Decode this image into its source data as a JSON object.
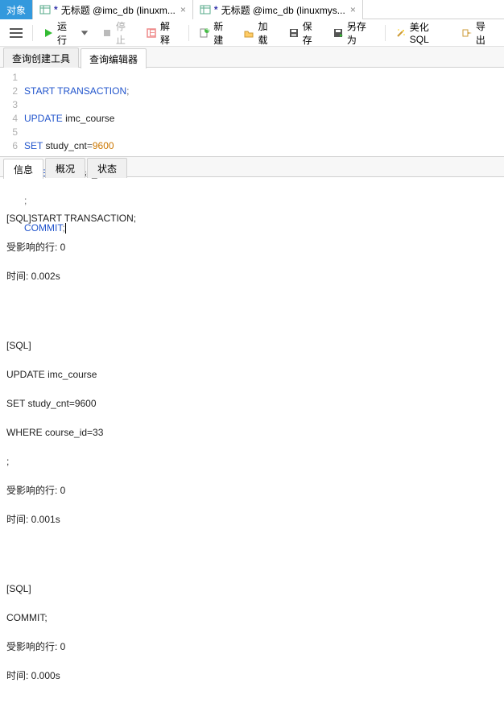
{
  "top_tabs": {
    "t0": "对象",
    "t1_dirty": "*",
    "t1": "无标题 @imc_db (linuxm...",
    "t2_dirty": "*",
    "t2": "无标题 @imc_db (linuxmys..."
  },
  "toolbar": {
    "run": "运行",
    "stop": "停止",
    "explain": "解释",
    "new": "新建",
    "load": "加载",
    "save": "保存",
    "saveas": "另存为",
    "beautify": "美化 SQL",
    "export": "导出"
  },
  "query_tabs": {
    "builder": "查询创建工具",
    "editor": "查询编辑器"
  },
  "sql": {
    "l1a": "START",
    "l1b": "TRANSACTION",
    "l1c": ";",
    "l2a": "UPDATE",
    "l2b": " imc_course",
    "l3a": "SET",
    "l3b": " study_cnt",
    "l3c": "=",
    "l3d": "9600",
    "l4a": "WHERE",
    "l4b": " course_id",
    "l4c": "=",
    "l4d": "33",
    "l5": ";",
    "l6a": "COMMIT",
    "l6b": ";",
    "ln1": "1",
    "ln2": "2",
    "ln3": "3",
    "ln4": "4",
    "ln5": "5",
    "ln6": "6"
  },
  "result_tabs": {
    "info": "信息",
    "profile": "概况",
    "status": "状态"
  },
  "output": {
    "b1l1": "[SQL]START TRANSACTION;",
    "b1l2": "受影响的行: 0",
    "b1l3": "时间: 0.002s",
    "b2l1": "[SQL]",
    "b2l2": "UPDATE imc_course",
    "b2l3": "SET study_cnt=9600",
    "b2l4": "WHERE course_id=33",
    "b2l5": ";",
    "b2l6": "受影响的行: 0",
    "b2l7": "时间: 0.001s",
    "b3l1": "[SQL]",
    "b3l2": "COMMIT;",
    "b3l3": "受影响的行: 0",
    "b3l4": "时间: 0.000s"
  }
}
